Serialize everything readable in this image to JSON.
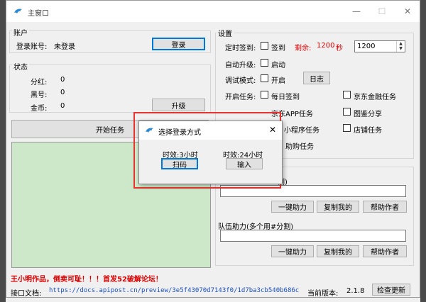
{
  "window": {
    "title": "主窗口",
    "min_label": "—",
    "max_label": "☐",
    "close_label": "✕"
  },
  "account": {
    "legend": "账户",
    "login_label": "登录账号:",
    "login_value": "未登录",
    "login_button": "登录"
  },
  "status": {
    "legend": "状态",
    "dividend_label": "分红:",
    "dividend_value": "0",
    "blacklist_label": "黑号:",
    "blacklist_value": "0",
    "coins_label": "金币:",
    "coins_value": "0",
    "upgrade_button": "升级"
  },
  "start_button": "开始任务",
  "settings": {
    "legend": "设置",
    "timed_signin_label": "定时签到:",
    "signin_checkbox": "签到",
    "remaining_label": "剩余:",
    "remaining_value": "1200",
    "remaining_unit": "秒",
    "interval_value": "1200",
    "auto_upgrade_label": "自动升级:",
    "auto_upgrade_checkbox": "启动",
    "debug_label": "调试模式:",
    "debug_checkbox": "开启",
    "log_button": "日志",
    "tasks_label": "开启任务:",
    "tasks": {
      "daily_signin": "每日签到",
      "jd_finance": "京东金融任务",
      "jd_app": "京东APP任务",
      "image_share": "图鉴分享",
      "mini_program": "小程序任务",
      "shop_task": "店铺任务",
      "group_buy_partial": "助购任务"
    }
  },
  "help": {
    "legend_partial": "割)",
    "one_click": "一键助力",
    "copy_mine": "复制我的",
    "help_author": "帮助作者",
    "team_legend": "队伍助力(多个用#分割)",
    "team_one_click": "一键助力",
    "team_copy_mine": "复制我的",
    "team_help_author": "帮助作者"
  },
  "footer": {
    "notice": "王小明作品，倒卖可耻！！！首发52破解论坛！",
    "api_label": "接口文档:",
    "api_url": "https://docs.apipost.cn/preview/3e5f43070d7143f0/1d7ba3cb540b686c",
    "version_label": "当前版本:",
    "version_value": "2.1.8",
    "check_update": "检查更新"
  },
  "dialog": {
    "title": "选择登录方式",
    "close": "✕",
    "option1_label": "时效:3小时",
    "option1_button": "扫码",
    "option2_label": "时效:24小时",
    "option2_button": "输入"
  },
  "colors": {
    "highlight_box": "#e8332f",
    "log_area": "#cde8c8",
    "notice": "#e00000"
  }
}
